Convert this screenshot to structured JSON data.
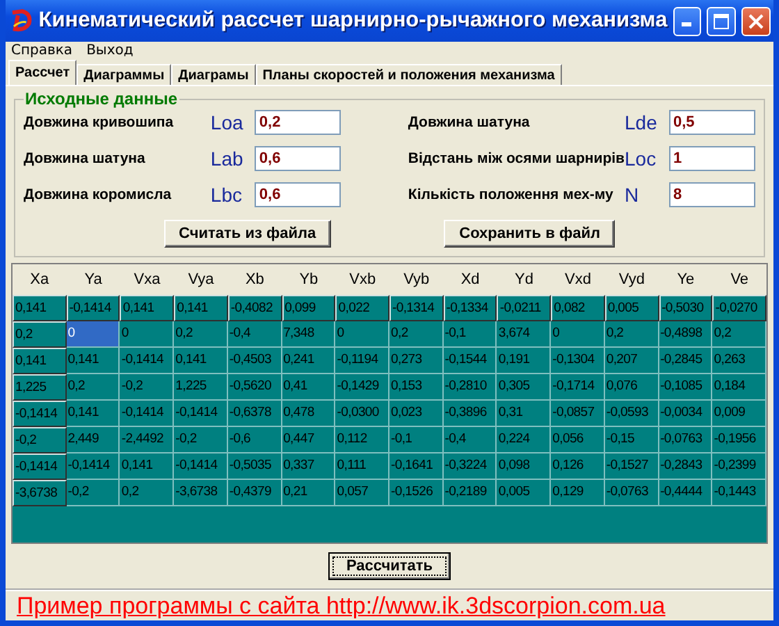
{
  "window": {
    "title": "Кинематический рассчет шарнирно-рычажного механизма"
  },
  "menu": [
    {
      "label": "Справка"
    },
    {
      "label": "Выход"
    }
  ],
  "tabs": [
    {
      "label": "Рассчет",
      "selected": true
    },
    {
      "label": "Диаграммы",
      "selected": false
    },
    {
      "label": "Диаграмы",
      "selected": false
    },
    {
      "label": "Планы скоростей и положения механизма",
      "selected": false
    }
  ],
  "input_group": {
    "title": "Исходные данные",
    "left": [
      {
        "label": "Довжина кривошипа",
        "symbol": "Loa",
        "value": "0,2"
      },
      {
        "label": "Довжина шатуна",
        "symbol": "Lab",
        "value": "0,6"
      },
      {
        "label": "Довжина коромисла",
        "symbol": "Lbc",
        "value": "0,6"
      }
    ],
    "right": [
      {
        "label": "Довжина шатуна",
        "symbol": "Lde",
        "value": "0,5"
      },
      {
        "label": "Відстань між осями шарнирів",
        "symbol": "Loc",
        "value": "1"
      },
      {
        "label": "Кількість положення мех-му",
        "symbol": "N",
        "value": "8"
      }
    ],
    "buttons": [
      "Считать из файла",
      "Сохранить в файл"
    ]
  },
  "table": {
    "columns": [
      "Xa",
      "Ya",
      "Vxa",
      "Vya",
      "Xb",
      "Yb",
      "Vxb",
      "Vyb",
      "Xd",
      "Yd",
      "Vxd",
      "Vyd",
      "Ye",
      "Ve"
    ],
    "rows": [
      {
        "cells": [
          {
            "text": "0,141",
            "selected": false
          },
          {
            "text": "-0,1414",
            "selected": false
          },
          {
            "text": "0,141",
            "selected": false
          },
          {
            "text": "0,141",
            "selected": false
          },
          {
            "text": "-0,4082",
            "selected": false
          },
          {
            "text": "0,099",
            "selected": false
          },
          {
            "text": "0,022",
            "selected": false
          },
          {
            "text": "-0,1314",
            "selected": false
          },
          {
            "text": "-0,1334",
            "selected": false
          },
          {
            "text": "-0,0211",
            "selected": false
          },
          {
            "text": "0,082",
            "selected": false
          },
          {
            "text": "0,005",
            "selected": false
          },
          {
            "text": "-0,5030",
            "selected": false
          },
          {
            "text": "-0,0270",
            "selected": false
          }
        ]
      },
      {
        "cells": [
          {
            "text": "0,2",
            "selected": false
          },
          {
            "text": "0",
            "selected": true
          },
          {
            "text": "0",
            "selected": false
          },
          {
            "text": "0,2",
            "selected": false
          },
          {
            "text": "-0,4",
            "selected": false
          },
          {
            "text": "7,348",
            "selected": false
          },
          {
            "text": "0",
            "selected": false
          },
          {
            "text": "0,2",
            "selected": false
          },
          {
            "text": "-0,1",
            "selected": false
          },
          {
            "text": "3,674",
            "selected": false
          },
          {
            "text": "0",
            "selected": false
          },
          {
            "text": "0,2",
            "selected": false
          },
          {
            "text": "-0,4898",
            "selected": false
          },
          {
            "text": "0,2",
            "selected": false
          }
        ]
      },
      {
        "cells": [
          {
            "text": "0,141",
            "selected": false
          },
          {
            "text": "0,141",
            "selected": false
          },
          {
            "text": "-0,1414",
            "selected": false
          },
          {
            "text": "0,141",
            "selected": false
          },
          {
            "text": "-0,4503",
            "selected": false
          },
          {
            "text": "0,241",
            "selected": false
          },
          {
            "text": "-0,1194",
            "selected": false
          },
          {
            "text": "0,273",
            "selected": false
          },
          {
            "text": "-0,1544",
            "selected": false
          },
          {
            "text": "0,191",
            "selected": false
          },
          {
            "text": "-0,1304",
            "selected": false
          },
          {
            "text": "0,207",
            "selected": false
          },
          {
            "text": "-0,2845",
            "selected": false
          },
          {
            "text": "0,263",
            "selected": false
          }
        ]
      },
      {
        "cells": [
          {
            "text": "1,225",
            "selected": false
          },
          {
            "text": "0,2",
            "selected": false
          },
          {
            "text": "-0,2",
            "selected": false
          },
          {
            "text": "1,225",
            "selected": false
          },
          {
            "text": "-0,5620",
            "selected": false
          },
          {
            "text": "0,41",
            "selected": false
          },
          {
            "text": "-0,1429",
            "selected": false
          },
          {
            "text": "0,153",
            "selected": false
          },
          {
            "text": "-0,2810",
            "selected": false
          },
          {
            "text": "0,305",
            "selected": false
          },
          {
            "text": "-0,1714",
            "selected": false
          },
          {
            "text": "0,076",
            "selected": false
          },
          {
            "text": "-0,1085",
            "selected": false
          },
          {
            "text": "0,184",
            "selected": false
          }
        ]
      },
      {
        "cells": [
          {
            "text": "-0,1414",
            "selected": false
          },
          {
            "text": "0,141",
            "selected": false
          },
          {
            "text": "-0,1414",
            "selected": false
          },
          {
            "text": "-0,1414",
            "selected": false
          },
          {
            "text": "-0,6378",
            "selected": false
          },
          {
            "text": "0,478",
            "selected": false
          },
          {
            "text": "-0,0300",
            "selected": false
          },
          {
            "text": "0,023",
            "selected": false
          },
          {
            "text": "-0,3896",
            "selected": false
          },
          {
            "text": "0,31",
            "selected": false
          },
          {
            "text": "-0,0857",
            "selected": false
          },
          {
            "text": "-0,0593",
            "selected": false
          },
          {
            "text": "-0,0034",
            "selected": false
          },
          {
            "text": "0,009",
            "selected": false
          }
        ]
      },
      {
        "cells": [
          {
            "text": "-0,2",
            "selected": false
          },
          {
            "text": "2,449",
            "selected": false
          },
          {
            "text": "-2,4492",
            "selected": false
          },
          {
            "text": "-0,2",
            "selected": false
          },
          {
            "text": "-0,6",
            "selected": false
          },
          {
            "text": "0,447",
            "selected": false
          },
          {
            "text": "0,112",
            "selected": false
          },
          {
            "text": "-0,1",
            "selected": false
          },
          {
            "text": "-0,4",
            "selected": false
          },
          {
            "text": "0,224",
            "selected": false
          },
          {
            "text": "0,056",
            "selected": false
          },
          {
            "text": "-0,15",
            "selected": false
          },
          {
            "text": "-0,0763",
            "selected": false
          },
          {
            "text": "-0,1956",
            "selected": false
          }
        ]
      },
      {
        "cells": [
          {
            "text": "-0,1414",
            "selected": false
          },
          {
            "text": "-0,1414",
            "selected": false
          },
          {
            "text": "0,141",
            "selected": false
          },
          {
            "text": "-0,1414",
            "selected": false
          },
          {
            "text": "-0,5035",
            "selected": false
          },
          {
            "text": "0,337",
            "selected": false
          },
          {
            "text": "0,111",
            "selected": false
          },
          {
            "text": "-0,1641",
            "selected": false
          },
          {
            "text": "-0,3224",
            "selected": false
          },
          {
            "text": "0,098",
            "selected": false
          },
          {
            "text": "0,126",
            "selected": false
          },
          {
            "text": "-0,1527",
            "selected": false
          },
          {
            "text": "-0,2843",
            "selected": false
          },
          {
            "text": "-0,2399",
            "selected": false
          }
        ]
      },
      {
        "cells": [
          {
            "text": "-3,6738",
            "selected": false
          },
          {
            "text": "-0,2",
            "selected": false
          },
          {
            "text": "0,2",
            "selected": false
          },
          {
            "text": "-3,6738",
            "selected": false
          },
          {
            "text": "-0,4379",
            "selected": false
          },
          {
            "text": "0,21",
            "selected": false
          },
          {
            "text": "0,057",
            "selected": false
          },
          {
            "text": "-0,1526",
            "selected": false
          },
          {
            "text": "-0,2189",
            "selected": false
          },
          {
            "text": "0,005",
            "selected": false
          },
          {
            "text": "0,129",
            "selected": false
          },
          {
            "text": "-0,0763",
            "selected": false
          },
          {
            "text": "-0,4444",
            "selected": false
          },
          {
            "text": "-0,1443",
            "selected": false
          }
        ]
      }
    ]
  },
  "calculate_button": "Рассчитать",
  "footer_link": "Пример программы с сайта http://www.ik.3dscorpion.com.ua"
}
